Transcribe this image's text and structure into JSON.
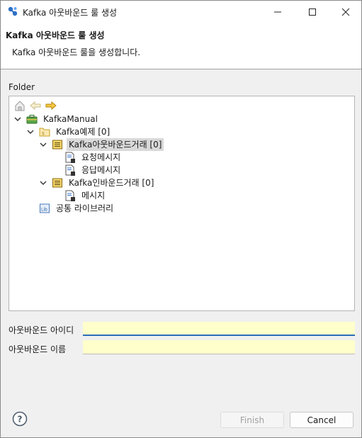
{
  "window": {
    "title": "Kafka 아웃바운드 룰 생성",
    "controls": [
      "minimize-icon",
      "maximize-icon",
      "close-icon"
    ]
  },
  "header": {
    "title": "Kafka 아웃바운드 룰 생성",
    "description": "Kafka 아웃바운드 룰을 생성합니다."
  },
  "folder": {
    "label": "Folder",
    "toolbar": [
      "home-icon",
      "back-arrow-icon",
      "forward-arrow-icon"
    ],
    "tree": [
      {
        "label": "KafkaManual",
        "icon": "project-briefcase-icon",
        "expanded": true
      },
      {
        "label": "Kafka예제 [0]",
        "icon": "package-folder-icon",
        "expanded": true
      },
      {
        "label": "Kafka아웃바운드거래 [0]",
        "icon": "transaction-icon",
        "expanded": true,
        "selected": true
      },
      {
        "label": "요청메시지",
        "icon": "message-doc-icon"
      },
      {
        "label": "응답메시지",
        "icon": "message-doc-icon"
      },
      {
        "label": "Kafka인바운드거래 [0]",
        "icon": "transaction-icon",
        "expanded": true
      },
      {
        "label": "메시지",
        "icon": "message-doc-icon"
      },
      {
        "label": "공통 라이브러리",
        "icon": "library-icon"
      }
    ]
  },
  "form": {
    "outbound_id_label": "아웃바운드 아이디",
    "outbound_id_value": "",
    "outbound_name_label": "아웃바운드 이름",
    "outbound_name_value": ""
  },
  "buttons": {
    "finish": "Finish",
    "cancel": "Cancel"
  },
  "colors": {
    "input_bg": "#ffffcc",
    "focus": "#2b6cb7",
    "selection": "#d9d9d9"
  }
}
